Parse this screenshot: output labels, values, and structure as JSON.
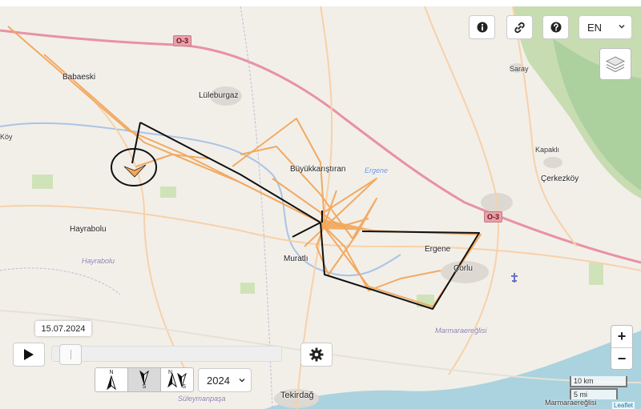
{
  "controls": {
    "info_icon": "info-circle-icon",
    "link_icon": "link-icon",
    "help_icon": "question-circle-icon",
    "language": "EN",
    "layers_icon": "layers-icon",
    "zoom_in": "+",
    "zoom_out": "−"
  },
  "timeline": {
    "date": "15.07.2024",
    "progress": 0.04,
    "play_icon": "play-icon",
    "settings_icon": "gear-icon"
  },
  "arrow_modes": {
    "north_label": "N",
    "south_label": "S",
    "active_index": 1
  },
  "year": "2024",
  "scale": {
    "km": "10 km",
    "mi": "5 mi"
  },
  "attribution": "Leaflet",
  "places": {
    "babaeski": "Babaeski",
    "luleburgaz": "Lüleburgaz",
    "saray": "Saray",
    "koy": "Köy",
    "buyukkaristiran": "Büyükkarıştıran",
    "ergene_river": "Ergene",
    "kapakli": "Kapaklı",
    "cerkezkoy": "Çerkezköy",
    "hayrabolu": "Hayrabolu",
    "hayrabolu_region": "Hayrabolu",
    "muratli": "Muratlı",
    "ergene_town": "Ergene",
    "corlu": "Çorlu",
    "marmaraereglisi_region": "Marmaraereğlisi",
    "marmaraereglisi": "Marmaraereğlisi",
    "tekirdag": "Tekirdağ",
    "suleymanpasa": "Süleymanpaşa"
  },
  "roads": {
    "shield_1": "O-3",
    "shield_2": "O-3"
  },
  "colors": {
    "track": "#f2a65a",
    "trajectory": "#000000",
    "land": "#f2efe9",
    "sea": "#aad3df",
    "forest": "#add19e",
    "road_primary": "#e892a2"
  }
}
